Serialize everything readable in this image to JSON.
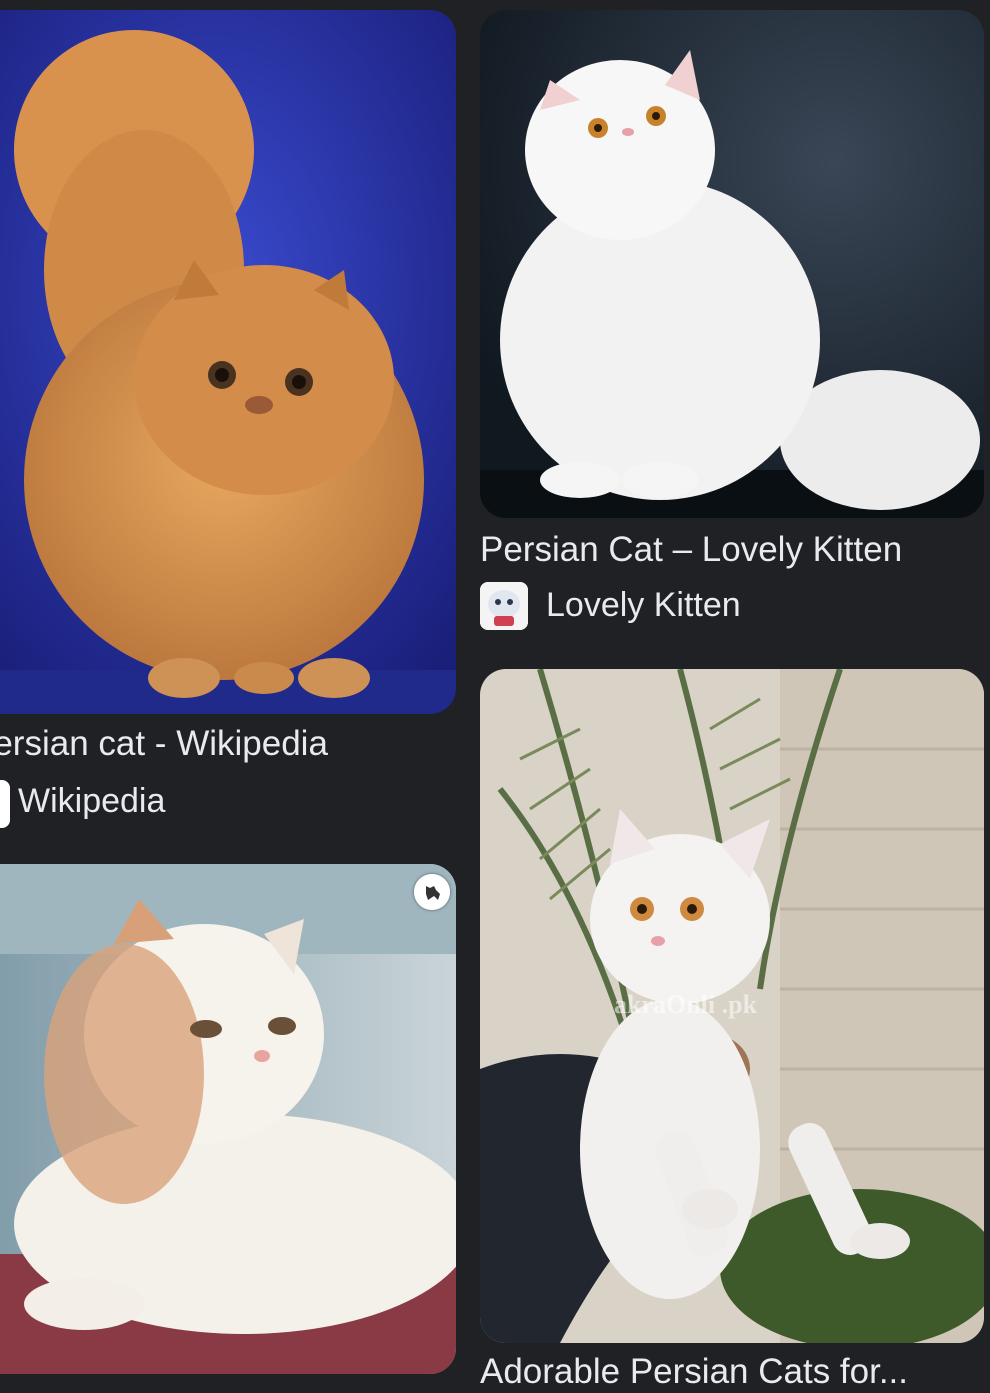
{
  "results": [
    {
      "title": "Persian cat - Wikipedia",
      "source": "Wikipedia",
      "favicon": "wikipedia-w-icon"
    },
    {
      "title": "Persian Cat – Lovely Kitten",
      "source": "Lovely Kitten",
      "favicon": "lovely-kitten-cat-icon"
    },
    {
      "badge_icon": "dog-badge-icon"
    },
    {
      "title": "Adorable Persian Cats for...",
      "watermark": "akraOnli .pk"
    }
  ],
  "colors": {
    "background": "#202124",
    "text": "#e8eaed"
  }
}
